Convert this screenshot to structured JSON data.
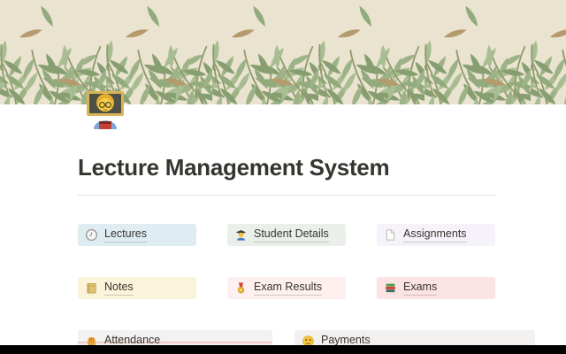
{
  "page": {
    "title": "Lecture Management System",
    "icon": "woman-teacher-emoji"
  },
  "cards": {
    "items": [
      {
        "label": "Lectures",
        "icon": "clock-icon",
        "bg": "#dfecf2"
      },
      {
        "label": "Student Details",
        "icon": "student-icon",
        "bg": "#eaf0e9"
      },
      {
        "label": "Assignments",
        "icon": "page-icon",
        "bg": "#f5f3f9"
      },
      {
        "label": "Notes",
        "icon": "notebook-icon",
        "bg": "#fbf3da"
      },
      {
        "label": "Exam Results",
        "icon": "medal-icon",
        "bg": "#fdf0ef"
      },
      {
        "label": "Exams",
        "icon": "books-icon",
        "bg": "#fbe3e3"
      },
      {
        "label": "Attendance",
        "icon": "raised-hand-icon",
        "bg": "#f3f2f0"
      },
      {
        "label": "Payments",
        "icon": "money-face-icon",
        "bg": "#f2f1ef"
      }
    ]
  },
  "colors": {
    "banner_background": "#e9e3d0",
    "leaf_green_light": "#a9bd92",
    "leaf_green_mid": "#9db387",
    "leaf_green_dark": "#869e70",
    "leaf_brown": "#b49a6c",
    "text": "#37352f",
    "divider": "#e5e3e0",
    "letterbox": "#000000"
  }
}
